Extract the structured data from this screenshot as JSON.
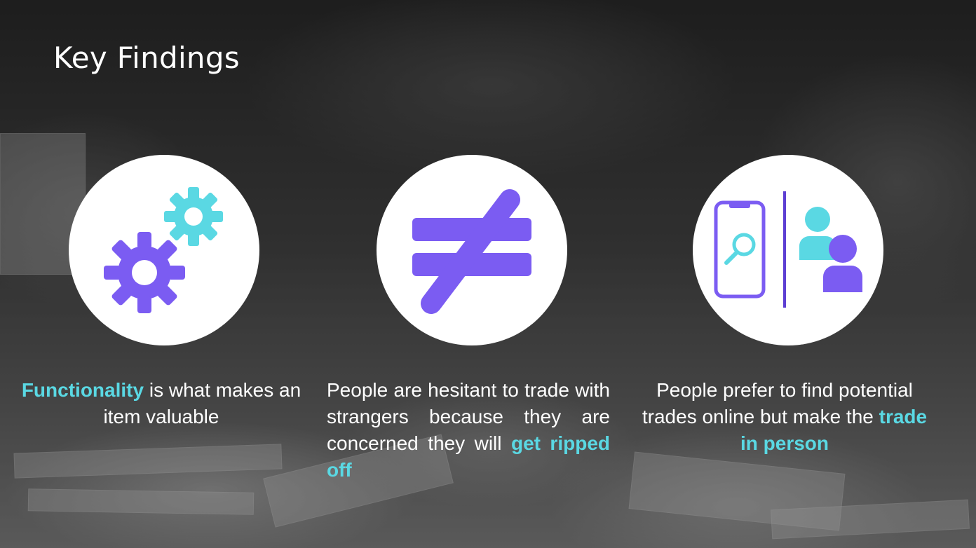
{
  "slide": {
    "title": "Key Findings"
  },
  "colors": {
    "accent_purple": "#7b5cf2",
    "accent_cyan": "#5ad8e3",
    "text": "#ffffff"
  },
  "findings": [
    {
      "icon": "gears-icon",
      "highlight": "Functionality",
      "text": " is what makes an item valuable"
    },
    {
      "icon": "not-equal-icon",
      "text": "People are hesitant to trade with strangers because they are concerned they will ",
      "highlight": "get ripped off"
    },
    {
      "icon": "phone-search-and-people-icon",
      "text": "People prefer to find potential trades online but make the ",
      "highlight": "trade in person"
    }
  ]
}
